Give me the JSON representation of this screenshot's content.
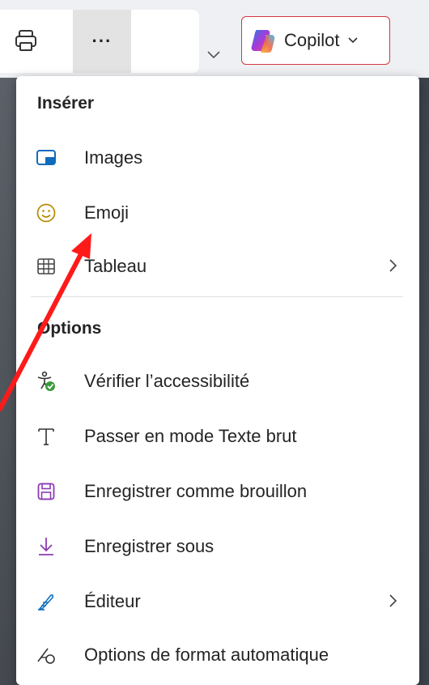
{
  "toolbar": {
    "more_label": "···",
    "copilot_label": "Copilot"
  },
  "menu": {
    "section_insert": "Insérer",
    "section_options": "Options",
    "items": [
      {
        "label": "Images",
        "icon": "image-icon"
      },
      {
        "label": "Emoji",
        "icon": "emoji-icon"
      },
      {
        "label": "Tableau",
        "icon": "table-icon",
        "submenu": true
      },
      {
        "label": "Vérifier l’accessibilité",
        "icon": "accessibility-check-icon"
      },
      {
        "label": "Passer en mode Texte brut",
        "icon": "text-icon"
      },
      {
        "label": "Enregistrer comme brouillon",
        "icon": "save-icon"
      },
      {
        "label": "Enregistrer sous",
        "icon": "download-icon"
      },
      {
        "label": "Éditeur",
        "icon": "editor-pen-icon",
        "submenu": true
      },
      {
        "label": "Options de format automatique",
        "icon": "autoformat-icon"
      }
    ]
  },
  "colors": {
    "accent_blue": "#0f6cbd",
    "accent_purple": "#8c3bb5",
    "annotation_red": "#ff1a1a",
    "copilot_border": "#d6373f"
  }
}
